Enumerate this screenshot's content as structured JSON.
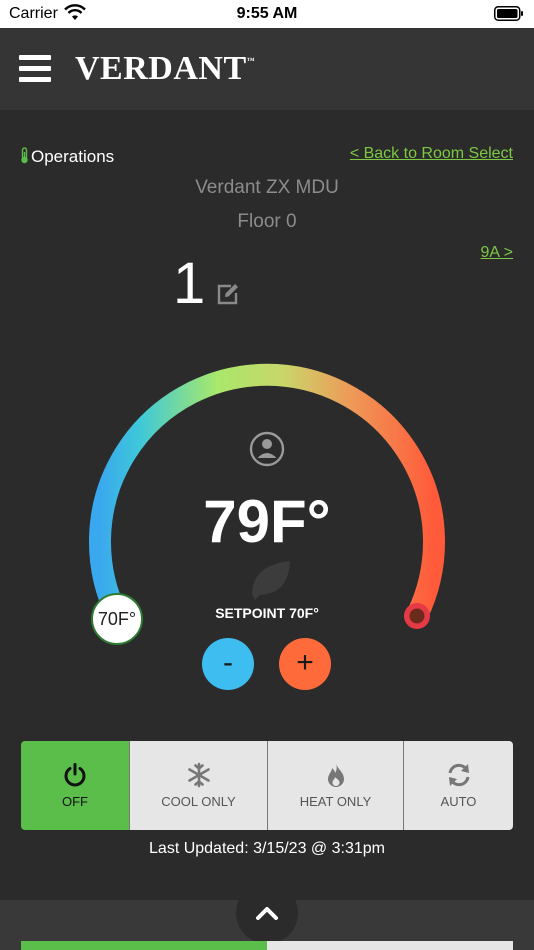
{
  "status_bar": {
    "carrier": "Carrier",
    "time": "9:55 AM"
  },
  "header": {
    "logo_text": "VERDANT",
    "logo_tm": "™"
  },
  "location": {
    "section": "Operations",
    "back_link": "< Back to Room Select",
    "building": "Verdant ZX MDU",
    "floor": "Floor 0",
    "next_room_link": "9A >",
    "room": "1"
  },
  "thermostat": {
    "current_temp": "79F°",
    "setpoint_label": "SETPOINT 70F°",
    "setpoint_knob": "70F°",
    "minus_label": "-",
    "plus_label": "+"
  },
  "modes": [
    {
      "label": "OFF",
      "icon": "power-icon",
      "active": true
    },
    {
      "label": "COOL ONLY",
      "icon": "snowflake-icon",
      "active": false
    },
    {
      "label": "HEAT ONLY",
      "icon": "flame-icon",
      "active": false
    },
    {
      "label": "AUTO",
      "icon": "refresh-icon",
      "active": false
    }
  ],
  "last_updated": "Last Updated: 3/15/23 @ 3:31pm",
  "colors": {
    "accent_green": "#5bbd4a",
    "link_green": "#7cc843",
    "cool_blue": "#3ebef0",
    "heat_orange": "#ff6a3a",
    "background": "#2b2b2b"
  }
}
